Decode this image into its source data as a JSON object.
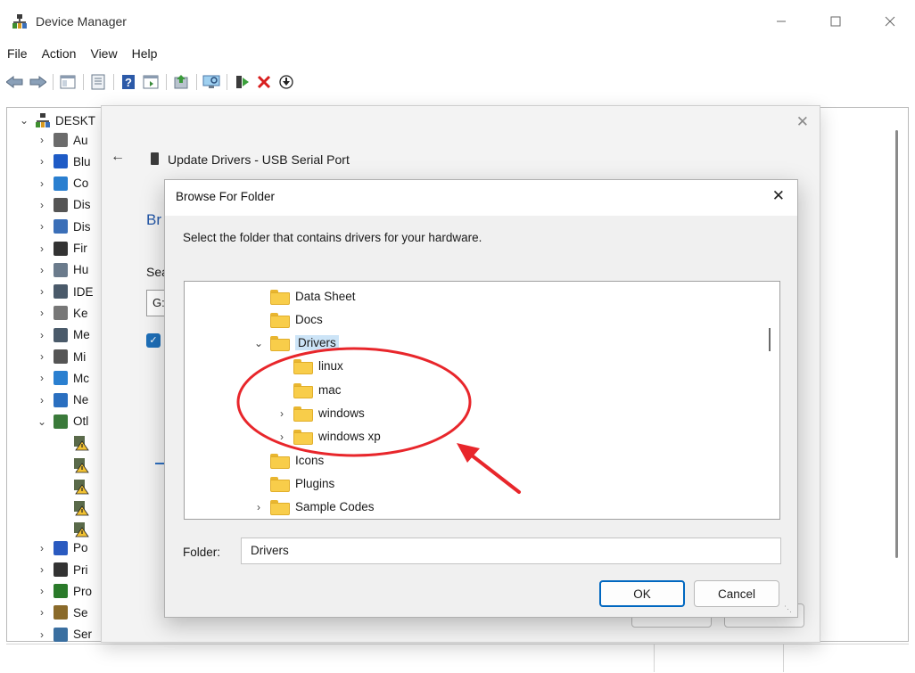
{
  "window": {
    "title": "Device Manager"
  },
  "menu": {
    "items": [
      "File",
      "Action",
      "View",
      "Help"
    ]
  },
  "toolbar": {
    "buttons": [
      "back-icon",
      "forward-icon",
      "properties-icon",
      "view-icon",
      "help-icon",
      "details-icon",
      "update-driver-icon",
      "scan-hardware-icon",
      "enable-device-icon",
      "uninstall-icon",
      "download-icon"
    ]
  },
  "tree": {
    "root_label": "DESKT",
    "items": [
      {
        "label": "Au",
        "icon": "audio-icon"
      },
      {
        "label": "Blu",
        "icon": "bluetooth-icon"
      },
      {
        "label": "Co",
        "icon": "computer-icon"
      },
      {
        "label": "Dis",
        "icon": "disk-drive-icon"
      },
      {
        "label": "Dis",
        "icon": "display-adapter-icon"
      },
      {
        "label": "Fir",
        "icon": "firmware-icon"
      },
      {
        "label": "Hu",
        "icon": "hid-icon"
      },
      {
        "label": "IDE",
        "icon": "ide-icon"
      },
      {
        "label": "Ke",
        "icon": "keyboard-icon"
      },
      {
        "label": "Me",
        "icon": "memory-icon"
      },
      {
        "label": "Mi",
        "icon": "mouse-icon"
      },
      {
        "label": "Mc",
        "icon": "monitor-icon"
      },
      {
        "label": "Ne",
        "icon": "network-icon"
      },
      {
        "label": "Otl",
        "icon": "other-devices-icon"
      },
      {
        "label": "Po",
        "icon": "ports-icon"
      },
      {
        "label": "Pri",
        "icon": "print-queue-icon"
      },
      {
        "label": "Pro",
        "icon": "processor-icon"
      },
      {
        "label": "Se",
        "icon": "security-icon"
      },
      {
        "label": "Ser",
        "icon": "software-icon"
      }
    ]
  },
  "update_dialog": {
    "title": "Update Drivers - USB Serial Port",
    "heading": "Br",
    "search_label": "Sea",
    "path_value": "G:"
  },
  "browse_dialog": {
    "title": "Browse For Folder",
    "instruction": "Select the folder that contains drivers for your hardware.",
    "folders": [
      {
        "label": "Data Sheet",
        "level": 1,
        "expander": "",
        "selected": false
      },
      {
        "label": "Docs",
        "level": 1,
        "expander": "",
        "selected": false
      },
      {
        "label": "Drivers",
        "level": 1,
        "expander": "expanded",
        "selected": true
      },
      {
        "label": "linux",
        "level": 2,
        "expander": "",
        "selected": false
      },
      {
        "label": "mac",
        "level": 2,
        "expander": "",
        "selected": false
      },
      {
        "label": "windows",
        "level": 2,
        "expander": "collapsed",
        "selected": false
      },
      {
        "label": "windows xp",
        "level": 2,
        "expander": "collapsed",
        "selected": false
      },
      {
        "label": "Icons",
        "level": 1,
        "expander": "",
        "selected": false
      },
      {
        "label": "Plugins",
        "level": 1,
        "expander": "",
        "selected": false
      },
      {
        "label": "Sample Codes",
        "level": 1,
        "expander": "collapsed",
        "selected": false
      }
    ],
    "folder_label": "Folder:",
    "folder_value": "Drivers",
    "ok_label": "OK",
    "cancel_label": "Cancel"
  },
  "colors": {
    "accent": "#0067c0",
    "selection": "#cce4f7",
    "annotation": "#e8262b",
    "folder": "#f8cd4a"
  }
}
